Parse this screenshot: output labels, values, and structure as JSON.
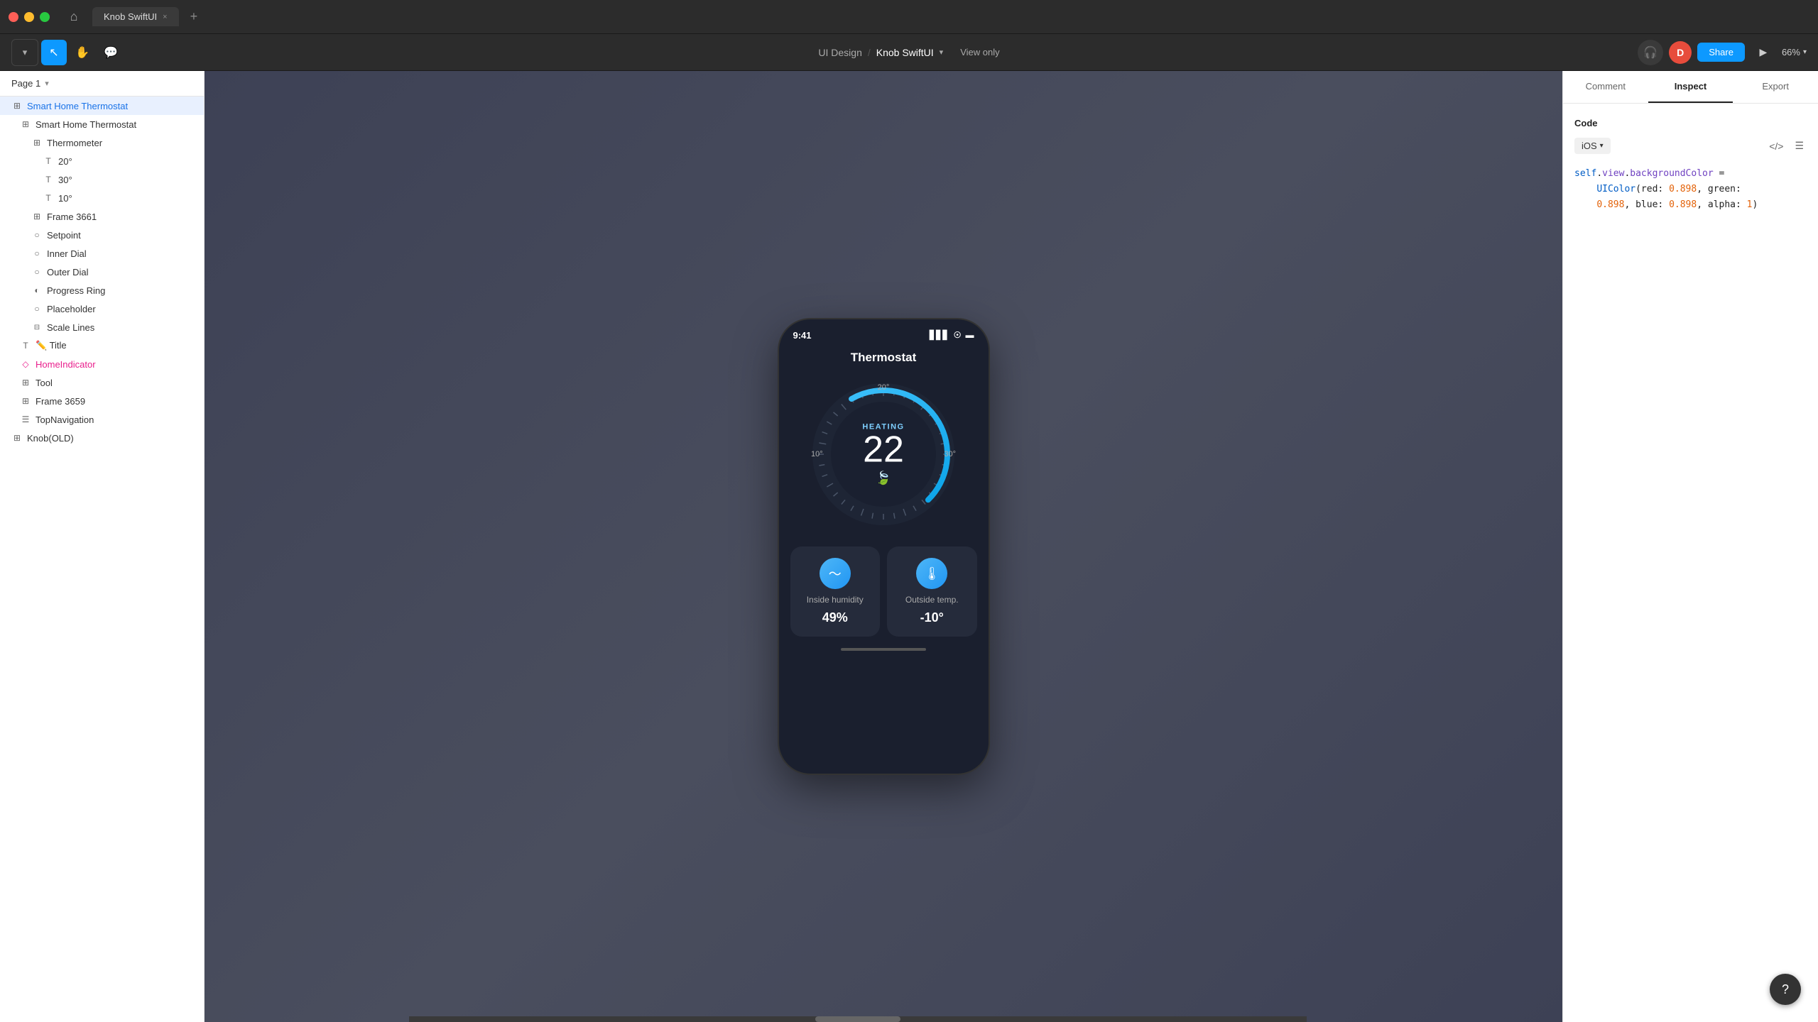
{
  "window": {
    "tab_name": "Knob SwiftUI",
    "close": "×",
    "add": "+"
  },
  "header": {
    "breadcrumb_part1": "UI Design",
    "separator": "/",
    "file_name": "Knob SwiftUI",
    "view_only": "View only",
    "avatar_letter": "D",
    "share_label": "Share",
    "zoom": "66%"
  },
  "sidebar": {
    "page_label": "Page 1",
    "items": [
      {
        "id": "smart-home-thermostat-root",
        "label": "Smart Home Thermostat",
        "icon": "##",
        "indent": 0,
        "selected": true
      },
      {
        "id": "smart-home-thermostat-child",
        "label": "Smart Home Thermostat",
        "icon": "##",
        "indent": 1,
        "selected": false
      },
      {
        "id": "thermometer",
        "label": "Thermometer",
        "icon": "##",
        "indent": 2,
        "selected": false
      },
      {
        "id": "20deg",
        "label": "20°",
        "icon": "T",
        "indent": 3,
        "selected": false
      },
      {
        "id": "30deg",
        "label": "30°",
        "icon": "T",
        "indent": 3,
        "selected": false
      },
      {
        "id": "10deg",
        "label": "10°",
        "icon": "T",
        "indent": 3,
        "selected": false
      },
      {
        "id": "frame-3661",
        "label": "Frame 3661",
        "icon": "##",
        "indent": 2,
        "selected": false
      },
      {
        "id": "setpoint",
        "label": "Setpoint",
        "icon": "○",
        "indent": 2,
        "selected": false
      },
      {
        "id": "inner-dial",
        "label": "Inner Dial",
        "icon": "○",
        "indent": 2,
        "selected": false
      },
      {
        "id": "outer-dial",
        "label": "Outer Dial",
        "icon": "○",
        "indent": 2,
        "selected": false
      },
      {
        "id": "progress-ring",
        "label": "Progress Ring",
        "icon": "◐",
        "indent": 2,
        "selected": false
      },
      {
        "id": "placeholder",
        "label": "Placeholder",
        "icon": "○",
        "indent": 2,
        "selected": false
      },
      {
        "id": "scale-lines",
        "label": "Scale Lines",
        "icon": "⊞",
        "indent": 2,
        "selected": false
      },
      {
        "id": "title",
        "label": "✏️ Title",
        "icon": "T",
        "indent": 1,
        "selected": false
      },
      {
        "id": "home-indicator",
        "label": "HomeIndicator",
        "icon": "◇",
        "indent": 1,
        "selected": false,
        "pink": true
      },
      {
        "id": "tool",
        "label": "Tool",
        "icon": "##",
        "indent": 1,
        "selected": false
      },
      {
        "id": "frame-3659",
        "label": "Frame 3659",
        "icon": "##",
        "indent": 1,
        "selected": false
      },
      {
        "id": "top-navigation",
        "label": "TopNavigation",
        "icon": "☰",
        "indent": 1,
        "selected": false
      },
      {
        "id": "knob-old",
        "label": "Knob(OLD)",
        "icon": "##",
        "indent": 0,
        "selected": false
      }
    ]
  },
  "phone": {
    "status_time": "9:41",
    "signal": "▋▋▋",
    "wifi": "wifi",
    "battery": "battery",
    "title": "Thermostat",
    "mode": "HEATING",
    "temperature": "22",
    "leaf_icon": "🍃",
    "label_top": "20°",
    "label_left": "10°",
    "label_right": "30°",
    "card1_label": "Inside humidity",
    "card1_value": "49%",
    "card2_label": "Outside temp.",
    "card2_value": "-10°"
  },
  "right_panel": {
    "tabs": [
      {
        "id": "comment",
        "label": "Comment"
      },
      {
        "id": "inspect",
        "label": "Inspect",
        "active": true
      },
      {
        "id": "export",
        "label": "Export"
      }
    ],
    "code_section_title": "Code",
    "platform": "iOS",
    "code_lines": [
      "self.view.backgroundColor =",
      "    UIColor(red: 0.898, green:",
      "    0.898, blue: 0.898, alpha: 1)"
    ]
  }
}
